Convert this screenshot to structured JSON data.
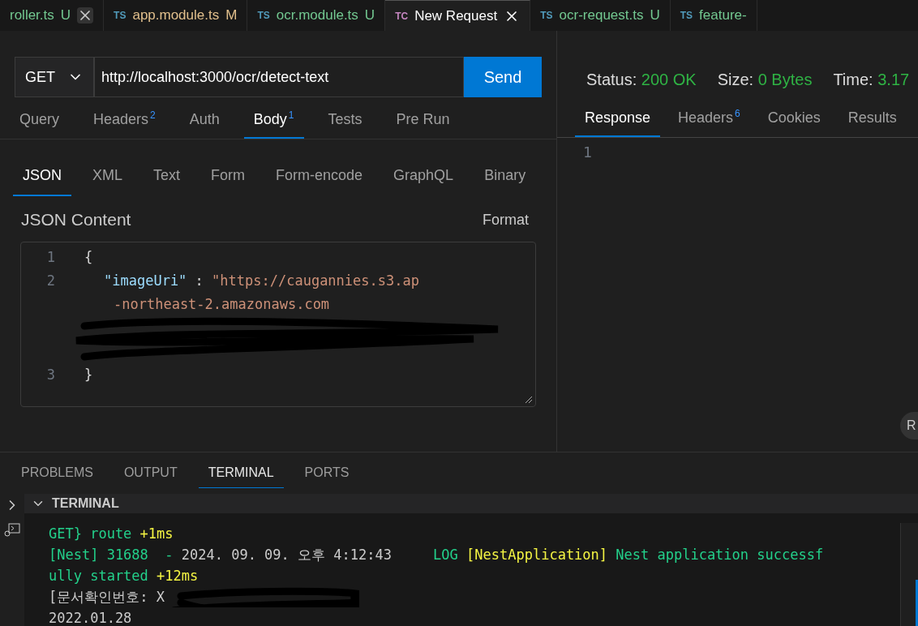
{
  "editor_tabs": [
    {
      "label": "roller.ts",
      "badge": "U",
      "color": "#73c991",
      "selected": false,
      "closable": true
    },
    {
      "icon": "TS",
      "label": "app.module.ts",
      "badge": "M",
      "color": "#e2c08d",
      "selected": false
    },
    {
      "icon": "TS",
      "label": "ocr.module.ts",
      "badge": "U",
      "color": "#73c991",
      "selected": false
    },
    {
      "icon": "TC",
      "label": "New Request",
      "color": "#ffffff",
      "selected": true,
      "closable": true
    },
    {
      "icon": "TS",
      "label": "ocr-request.ts",
      "badge": "U",
      "color": "#73c991",
      "selected": false
    },
    {
      "icon": "TS",
      "label": "feature-",
      "color": "#73c991",
      "selected": false
    }
  ],
  "request": {
    "method": "GET",
    "url": "http://localhost:3000/ocr/detect-text",
    "send": "Send"
  },
  "request_tabs": [
    {
      "label": "Query",
      "selected": false
    },
    {
      "label": "Headers",
      "count": "2",
      "selected": false
    },
    {
      "label": "Auth",
      "selected": false
    },
    {
      "label": "Body",
      "count": "1",
      "selected": true
    },
    {
      "label": "Tests",
      "selected": false
    },
    {
      "label": "Pre Run",
      "selected": false
    }
  ],
  "body_tabs": [
    {
      "label": "JSON",
      "selected": true
    },
    {
      "label": "XML",
      "selected": false
    },
    {
      "label": "Text",
      "selected": false
    },
    {
      "label": "Form",
      "selected": false
    },
    {
      "label": "Form-encode",
      "selected": false
    },
    {
      "label": "GraphQL",
      "selected": false
    },
    {
      "label": "Binary",
      "selected": false
    }
  ],
  "json_content": {
    "title": "JSON Content",
    "format": "Format",
    "lines": [
      {
        "number": "1",
        "kind": "brace",
        "text": "{"
      },
      {
        "number": "2",
        "kind": "pair",
        "key": "\"imageUri\"",
        "sep": " : ",
        "value": [
          "\"https://caugannies.s3.ap",
          "-northeast-2.amazonaws.com"
        ],
        "redacted": true
      },
      {
        "number": "3",
        "kind": "brace",
        "text": "}"
      }
    ]
  },
  "response": {
    "status_label": "Status:",
    "status": "200 OK",
    "size_label": "Size:",
    "size": "0 Bytes",
    "time_label": "Time:",
    "time": "3.17",
    "tabs": [
      {
        "label": "Response",
        "selected": true
      },
      {
        "label": "Headers",
        "count": "6",
        "selected": false
      },
      {
        "label": "Cookies",
        "selected": false
      },
      {
        "label": "Results",
        "selected": false
      }
    ],
    "line_number": "1",
    "corner_button": "R"
  },
  "panel_tabs": [
    {
      "label": "PROBLEMS",
      "selected": false
    },
    {
      "label": "OUTPUT",
      "selected": false
    },
    {
      "label": "TERMINAL",
      "selected": true
    },
    {
      "label": "PORTS",
      "selected": false
    }
  ],
  "terminal": {
    "title": "TERMINAL",
    "expanded": true,
    "lines": [
      {
        "segments": [
          {
            "color": "#23d18b",
            "text": "GET} route "
          },
          {
            "color": "#f5f543",
            "text": "+1ms"
          }
        ]
      },
      {
        "segments": [
          {
            "color": "#23d18b",
            "text": "[Nest] 31688  - "
          },
          {
            "color": "#cccccc",
            "text": "2024. 09. 09. 오후 4:12:43     "
          },
          {
            "color": "#23d18b",
            "text": "LOG "
          },
          {
            "color": "#f5f543",
            "text": "[NestApplication] "
          },
          {
            "color": "#23d18b",
            "text": "Nest application successf"
          }
        ]
      },
      {
        "segments": [
          {
            "color": "#23d18b",
            "text": "ully started "
          },
          {
            "color": "#f5f543",
            "text": "+12ms"
          }
        ]
      },
      {
        "redacted": true,
        "segments": [
          {
            "color": "#cccccc",
            "text": "[문서확인번호: X"
          }
        ]
      },
      {
        "segments": [
          {
            "color": "#cccccc",
            "text": "2022.01.28"
          }
        ]
      }
    ]
  }
}
